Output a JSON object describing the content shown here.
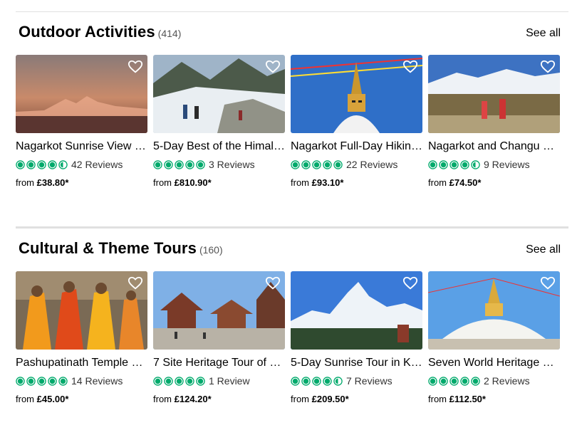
{
  "colors": {
    "rating_green": "#00aa6c",
    "divider": "#e0e0e0"
  },
  "icons": {
    "wishlist": "heart-outline-icon",
    "rating": "bubble-rating-icon"
  },
  "sections": [
    {
      "title": "Outdoor Activities",
      "count": "(414)",
      "see_all": "See all",
      "cards": [
        {
          "title": "Nagarkot Sunrise View …",
          "rating": 4.5,
          "reviews": "42 Reviews",
          "price_prefix": "from",
          "price": "£38.80*"
        },
        {
          "title": "5-Day Best of the Himal…",
          "rating": 5,
          "reviews": "3 Reviews",
          "price_prefix": "from",
          "price": "£810.90*"
        },
        {
          "title": "Nagarkot Full-Day Hikin…",
          "rating": 5,
          "reviews": "22 Reviews",
          "price_prefix": "from",
          "price": "£93.10*"
        },
        {
          "title": "Nagarkot and Changu …",
          "rating": 4.5,
          "reviews": "9 Reviews",
          "price_prefix": "from",
          "price": "£74.50*"
        }
      ]
    },
    {
      "title": "Cultural & Theme Tours",
      "count": "(160)",
      "see_all": "See all",
      "cards": [
        {
          "title": "Pashupatinath Temple …",
          "rating": 5,
          "reviews": "14 Reviews",
          "price_prefix": "from",
          "price": "£45.00*"
        },
        {
          "title": "7 Site Heritage Tour of …",
          "rating": 5,
          "reviews": "1 Review",
          "price_prefix": "from",
          "price": "£124.20*"
        },
        {
          "title": "5-Day Sunrise Tour in K…",
          "rating": 4.5,
          "reviews": "7 Reviews",
          "price_prefix": "from",
          "price": "£209.50*"
        },
        {
          "title": "Seven World Heritage …",
          "rating": 5,
          "reviews": "2 Reviews",
          "price_prefix": "from",
          "price": "£112.50*"
        }
      ]
    }
  ]
}
